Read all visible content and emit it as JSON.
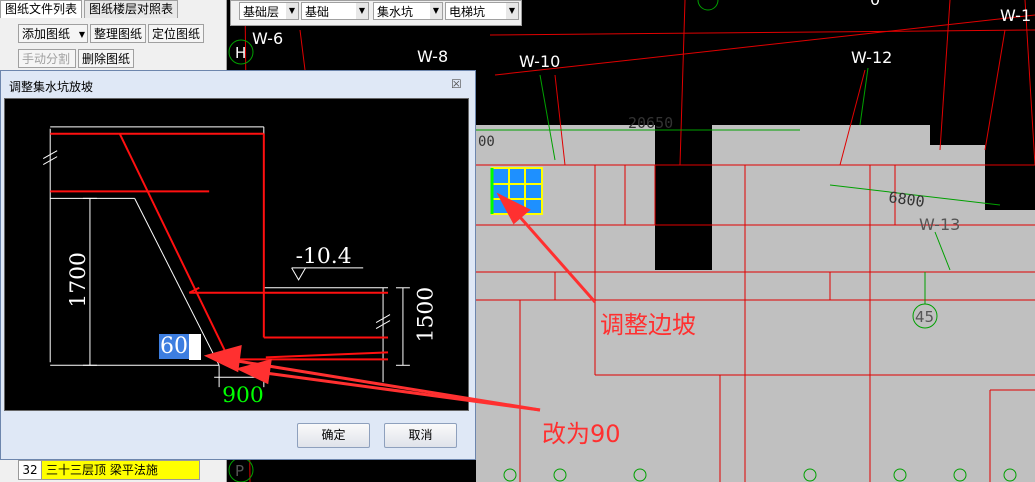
{
  "left_panel": {
    "tabs": [
      "图纸文件列表",
      "图纸楼层对照表"
    ],
    "buttons": {
      "add_drawing": "添加图纸",
      "organize_drawing": "整理图纸",
      "locate_drawing": "定位图纸",
      "manual_split": "手动分割",
      "delete_drawing": "删除图纸"
    },
    "row": {
      "num": "32",
      "name": "三十三层顶 梁平法施"
    }
  },
  "toolbar": {
    "floor": "基础层",
    "category": "基础",
    "type": "集水坑",
    "element": "电梯坑"
  },
  "dialog": {
    "title": "调整集水坑放坡",
    "close_glyph": "☒",
    "ok": "确定",
    "cancel": "取消",
    "dims": {
      "elev": "-10.4",
      "left_height": "1700",
      "right_height": "1500",
      "bottom": "900"
    },
    "edit_value": "60"
  },
  "cad": {
    "grid_labels": [
      "W-6",
      "W-8",
      "W-10",
      "W-12",
      "W-1",
      "W-13",
      "H",
      "P",
      "45"
    ],
    "dimension": "20650",
    "dimension2": "6800",
    "partial": "00"
  },
  "annotations": {
    "adjust_slope": "调整边坡",
    "change_to": "改为90"
  },
  "colors": {
    "annotation_red": "#ff3030",
    "cad_red": "#e00000",
    "grey_fill": "#c0c0c0",
    "axis_green": "#00c000",
    "selected_blue": "#1e90ff"
  }
}
